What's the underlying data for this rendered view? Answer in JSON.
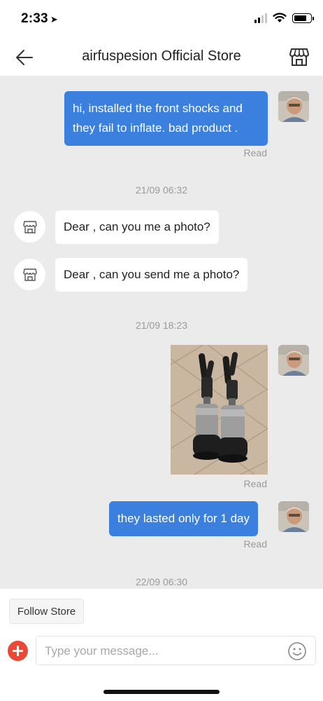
{
  "status_bar": {
    "time": "2:33",
    "location_arrow": "location-arrow-icon"
  },
  "header": {
    "title": "airfuspesion Official Store",
    "back_icon": "back-arrow-icon",
    "store_icon": "store-icon"
  },
  "messages": [
    {
      "type": "outgoing-text",
      "text": "hi, installed the front shocks and they fail to inflate. bad product .",
      "status": "Read"
    },
    {
      "type": "timestamp",
      "text": "21/09 06:32"
    },
    {
      "type": "incoming-text",
      "text": "Dear , can you me a photo?"
    },
    {
      "type": "incoming-text",
      "text": "Dear , can you send me a photo?"
    },
    {
      "type": "timestamp",
      "text": "21/09 18:23"
    },
    {
      "type": "outgoing-image",
      "image": "air-suspension-shocks-photo",
      "status": "Read"
    },
    {
      "type": "outgoing-text",
      "text": "they lasted only for 1 day",
      "status": "Read"
    },
    {
      "type": "timestamp",
      "text": "22/09 06:30"
    }
  ],
  "footer": {
    "follow_label": "Follow Store",
    "input_placeholder": "Type your message...",
    "input_value": "",
    "add_icon": "plus-icon",
    "emoji_icon": "emoji-icon"
  },
  "colors": {
    "outgoing_bubble": "#3b80de",
    "chat_background": "#ebebeb",
    "add_button": "#ea4a35"
  }
}
